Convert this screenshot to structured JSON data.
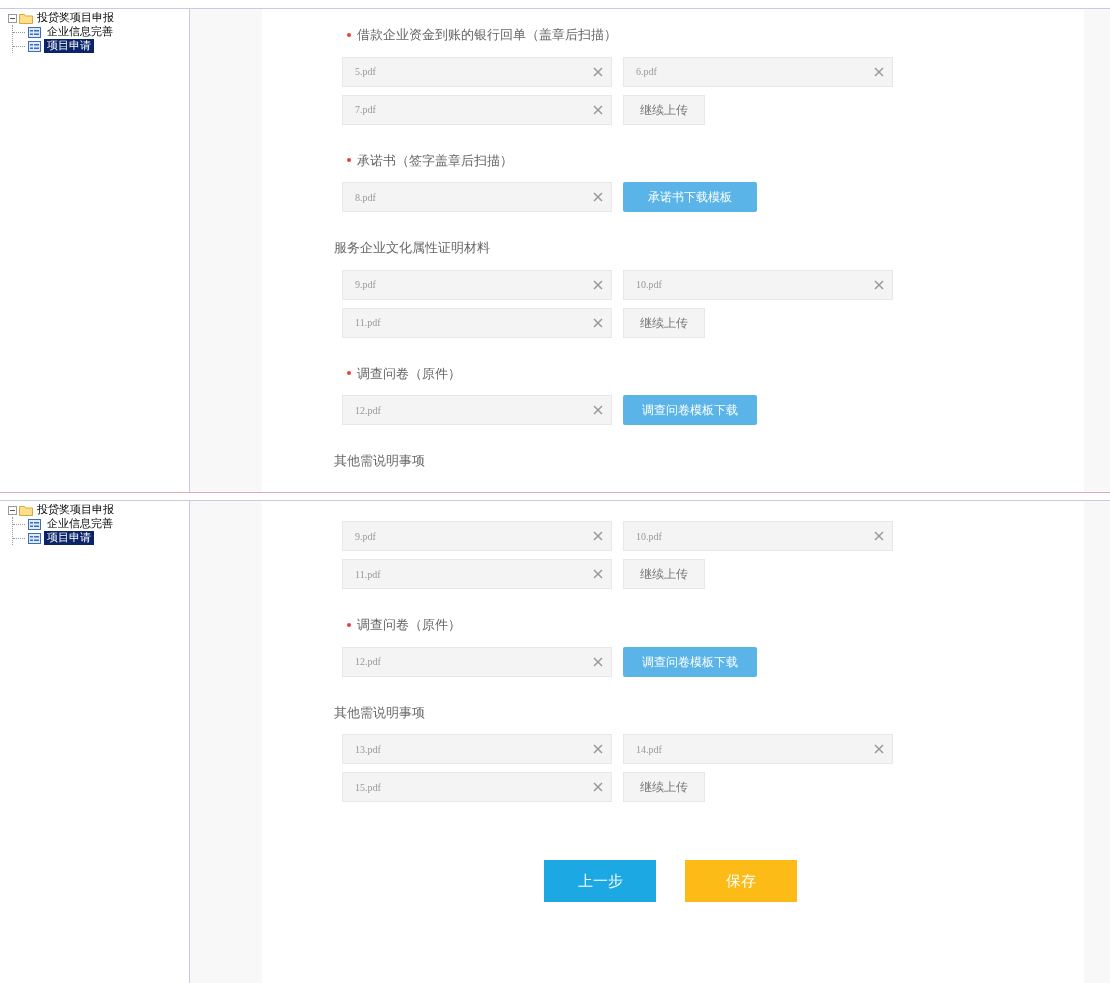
{
  "panels": [
    {
      "tree": {
        "label": "投贷奖项目申报",
        "expanded": true,
        "children": [
          {
            "label": "企业信息完善",
            "selected": false
          },
          {
            "label": "项目申请",
            "selected": true
          }
        ]
      },
      "sections": [
        {
          "label": "借款企业资金到账的银行回单（盖章后扫描）",
          "required": true,
          "files": [
            "5.pdf",
            "6.pdf",
            "7.pdf"
          ],
          "action": {
            "kind": "upload",
            "label": "继续上传"
          }
        },
        {
          "label": "承诺书（签字盖章后扫描）",
          "required": true,
          "files": [
            "8.pdf"
          ],
          "action": {
            "kind": "download",
            "label": "承诺书下载模板"
          }
        },
        {
          "label": "服务企业文化属性证明材料",
          "required": false,
          "files": [
            "9.pdf",
            "10.pdf",
            "11.pdf"
          ],
          "action": {
            "kind": "upload",
            "label": "继续上传"
          }
        },
        {
          "label": "调查问卷（原件）",
          "required": true,
          "files": [
            "12.pdf"
          ],
          "action": {
            "kind": "download",
            "label": "调查问卷模板下载"
          }
        },
        {
          "label": "其他需说明事项",
          "required": false
        }
      ]
    },
    {
      "tree": {
        "label": "投贷奖项目申报",
        "expanded": true,
        "children": [
          {
            "label": "企业信息完善",
            "selected": false
          },
          {
            "label": "项目申请",
            "selected": true
          }
        ]
      },
      "sections": [
        {
          "files": [
            "9.pdf",
            "10.pdf",
            "11.pdf"
          ],
          "action": {
            "kind": "upload",
            "label": "继续上传"
          }
        },
        {
          "label": "调查问卷（原件）",
          "required": true,
          "files": [
            "12.pdf"
          ],
          "action": {
            "kind": "download",
            "label": "调查问卷模板下载"
          }
        },
        {
          "label": "其他需说明事项",
          "required": false,
          "files": [
            "13.pdf",
            "14.pdf",
            "15.pdf"
          ],
          "action": {
            "kind": "upload",
            "label": "继续上传"
          }
        }
      ],
      "buttons": [
        {
          "kind": "back",
          "label": "上一步"
        },
        {
          "kind": "save",
          "label": "保存"
        }
      ]
    }
  ]
}
